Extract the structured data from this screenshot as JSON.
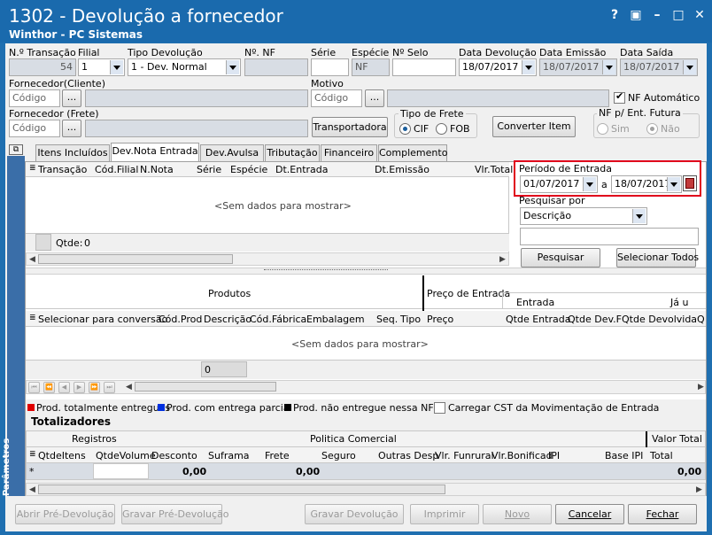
{
  "window": {
    "title": "1302 - Devolução a fornecedor",
    "subtitle": "Winthor - PC Sistemas",
    "help": "?",
    "restore": "▣",
    "minimize": "–",
    "maximize": "□",
    "close": "✕"
  },
  "header": {
    "transacao": {
      "label": "N.º Transação",
      "value": "54"
    },
    "filial": {
      "label": "Filial",
      "value": "1"
    },
    "tipo_devolucao": {
      "label": "Tipo Devolução",
      "value": "1 - Dev. Normal"
    },
    "nf": {
      "label": "Nº. NF",
      "value": ""
    },
    "serie": {
      "label": "Série",
      "value": ""
    },
    "especie": {
      "label": "Espécie",
      "value": "NF"
    },
    "selo": {
      "label": "Nº Selo",
      "value": ""
    },
    "data_devolucao": {
      "label": "Data Devolução",
      "value": "18/07/2017"
    },
    "data_emissao": {
      "label": "Data Emissão",
      "value": "18/07/2017"
    },
    "data_saida": {
      "label": "Data Saída",
      "value": "18/07/2017"
    },
    "fornecedor_cliente": {
      "label": "Fornecedor(Cliente)",
      "placeholder": "Código",
      "dots": "..."
    },
    "motivo": {
      "label": "Motivo",
      "placeholder": "Código",
      "dots": "..."
    },
    "nf_automatico": {
      "label": "NF Automático",
      "checked": true
    },
    "fornecedor_frete": {
      "label": "Fornecedor (Frete)",
      "placeholder": "Código",
      "dots": "..."
    },
    "transportadora_btn": "Transportadora",
    "tipo_frete": {
      "label": "Tipo de Frete",
      "cif": "CIF",
      "fob": "FOB",
      "selected": "CIF"
    },
    "converter_btn": "Converter Item",
    "nf_futura": {
      "label": "NF p/ Ent. Futura",
      "sim": "Sim",
      "nao": "Não",
      "selected": "Não"
    }
  },
  "tabs": [
    "Itens Incluídos",
    "Dev.Nota Entrada",
    "Dev.Avulsa",
    "Tributação",
    "Financeiro",
    "Complemento"
  ],
  "active_tab": "Dev.Nota Entrada",
  "nota_grid": {
    "columns": [
      "Transação",
      "Cód.Filial",
      "N.Nota",
      "Série",
      "Espécie",
      "Dt.Entrada",
      "Dt.Emissão",
      "Vlr.Total"
    ],
    "empty": "<Sem dados para mostrar>",
    "qtde_label": "Qtde:",
    "qtde": "0"
  },
  "filter": {
    "periodo_label": "Período de Entrada",
    "de": "01/07/2017",
    "a_label": "a",
    "ate": "18/07/2017",
    "pesquisar_por_label": "Pesquisar por",
    "pesquisar_por": "Descrição",
    "search_value": "",
    "pesquisar_btn": "Pesquisar",
    "selecionar_todos_btn": "Selecionar Todos"
  },
  "produtos_grid": {
    "group_produtos": "Produtos",
    "group_preco": "Preço de Entrada",
    "sub_entrada": "Entrada",
    "sub_ja": "Já u",
    "columns": [
      "Selecionar para conversão",
      "Cód.Prod",
      "Descrição",
      "Cód.Fábrica",
      "Embalagem",
      "Seq.",
      "Tipo",
      "Preço",
      "Qtde Entrada",
      "Qtde Dev.F",
      "Qtde Devolvida",
      "Q"
    ],
    "empty": "<Sem dados para mostrar>",
    "count": "0"
  },
  "legend": [
    {
      "label": "Prod. totalmente entregues",
      "color": "#e00000"
    },
    {
      "label": "Prod. com entrega parcial",
      "color": "#0030e0"
    },
    {
      "label": "Prod. não entregue nessa NF",
      "color": "#000000"
    }
  ],
  "carregar_cst": {
    "label": "Carregar CST da Movimentação de Entrada",
    "checked": false
  },
  "totalizadores": {
    "title": "Totalizadores",
    "registros": "Registros",
    "politica": "Politica Comercial",
    "valor_total": "Valor Total",
    "columns": [
      "QtdeItens",
      "QtdeVolume",
      "Desconto",
      "Suframa",
      "Frete",
      "Seguro",
      "Outras Desp",
      "Vlr. Funrural",
      "Vlr.Bonificad",
      "IPI",
      "Base IPI",
      "Total"
    ],
    "row_marker": "*",
    "desconto": "0,00",
    "frete": "0,00",
    "total": "0,00"
  },
  "side_label": "Parâmetros",
  "footer": {
    "abrir": "Abrir Pré-Devolução",
    "gravar_pre": "Gravar Pré-Devolução",
    "gravar": "Gravar Devolução",
    "imprimir": "Imprimir",
    "novo": "Novo",
    "cancelar": "Cancelar",
    "fechar": "Fechar"
  }
}
